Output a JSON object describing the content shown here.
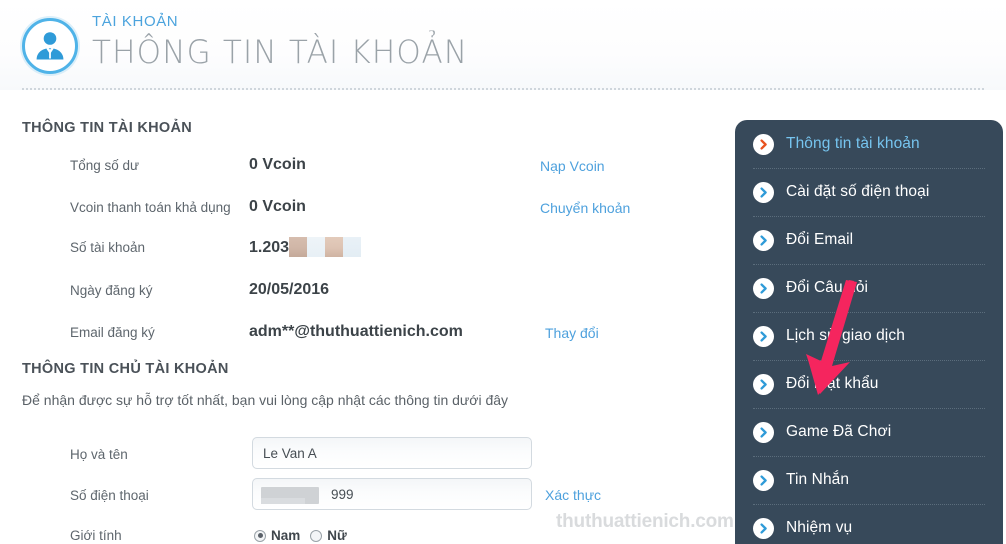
{
  "header": {
    "kicker": "TÀI KHOẢN",
    "title": "THÔNG TIN TÀI KHOẢN",
    "avatar_icon": "user-avatar-icon"
  },
  "account_info": {
    "section_title": "THÔNG TIN TÀI KHOẢN",
    "rows": [
      {
        "label": "Tổng số dư",
        "value": "0 Vcoin",
        "link": "Nạp Vcoin"
      },
      {
        "label": "Vcoin thanh toán khả dụng",
        "value": "0 Vcoin",
        "link": "Chuyển khoản"
      },
      {
        "label": "Số tài khoản",
        "value": "1.203",
        "link": ""
      },
      {
        "label": "Ngày đăng ký",
        "value": "20/05/2016",
        "link": ""
      },
      {
        "label": "Email đăng ký",
        "value": "adm**@thuthuattienich.com",
        "link": "Thay đổi"
      }
    ]
  },
  "owner_info": {
    "section_title": "THÔNG TIN CHỦ TÀI KHOẢN",
    "description": "Để nhận được sự hỗ trợ tốt nhất, bạn vui lòng cập nhật các thông tin dưới đây",
    "fullname": {
      "label": "Họ và tên",
      "value": "Le Van A",
      "placeholder": "Họ và tên"
    },
    "phone": {
      "label": "Số điện thoại",
      "value": "999",
      "placeholder": "Số điện thoại",
      "link": "Xác thực"
    },
    "gender": {
      "label": "Giới tính",
      "option_male": "Nam",
      "option_female": "Nữ",
      "selected": "Nam"
    }
  },
  "sidebar": {
    "items": [
      {
        "label": "Thông tin tài khoản",
        "icon": "chevron-right-circle-icon",
        "active": true
      },
      {
        "label": "Cài đặt số điện thoại",
        "icon": "chevron-right-circle-icon",
        "active": false
      },
      {
        "label": "Đổi Email",
        "icon": "chevron-right-circle-icon",
        "active": false
      },
      {
        "label": "Đổi Câu hỏi",
        "icon": "chevron-right-circle-icon",
        "active": false
      },
      {
        "label": "Lịch sử giao dịch",
        "icon": "chevron-right-circle-icon",
        "active": false
      },
      {
        "label": "Đổi mật khẩu",
        "icon": "chevron-right-circle-icon",
        "active": false
      },
      {
        "label": "Game Đã Chơi",
        "icon": "chevron-right-circle-icon",
        "active": false
      },
      {
        "label": "Tin Nhắn",
        "icon": "chevron-right-circle-icon",
        "active": false
      },
      {
        "label": "Nhiệm vụ",
        "icon": "chevron-right-circle-icon",
        "active": false
      }
    ]
  },
  "annotation": {
    "arrow_icon": "red-down-left-arrow-icon",
    "color": "#f5255e"
  },
  "watermark": {
    "text": "thuthuattienich.com"
  },
  "colors": {
    "accent_blue": "#4ea1dd",
    "sidebar_bg": "#37495a",
    "active_item": "#76c4ef",
    "arrow_red": "#f5255e",
    "icon_blue": "#2f9bd8",
    "active_icon_orange": "#e8521f"
  }
}
